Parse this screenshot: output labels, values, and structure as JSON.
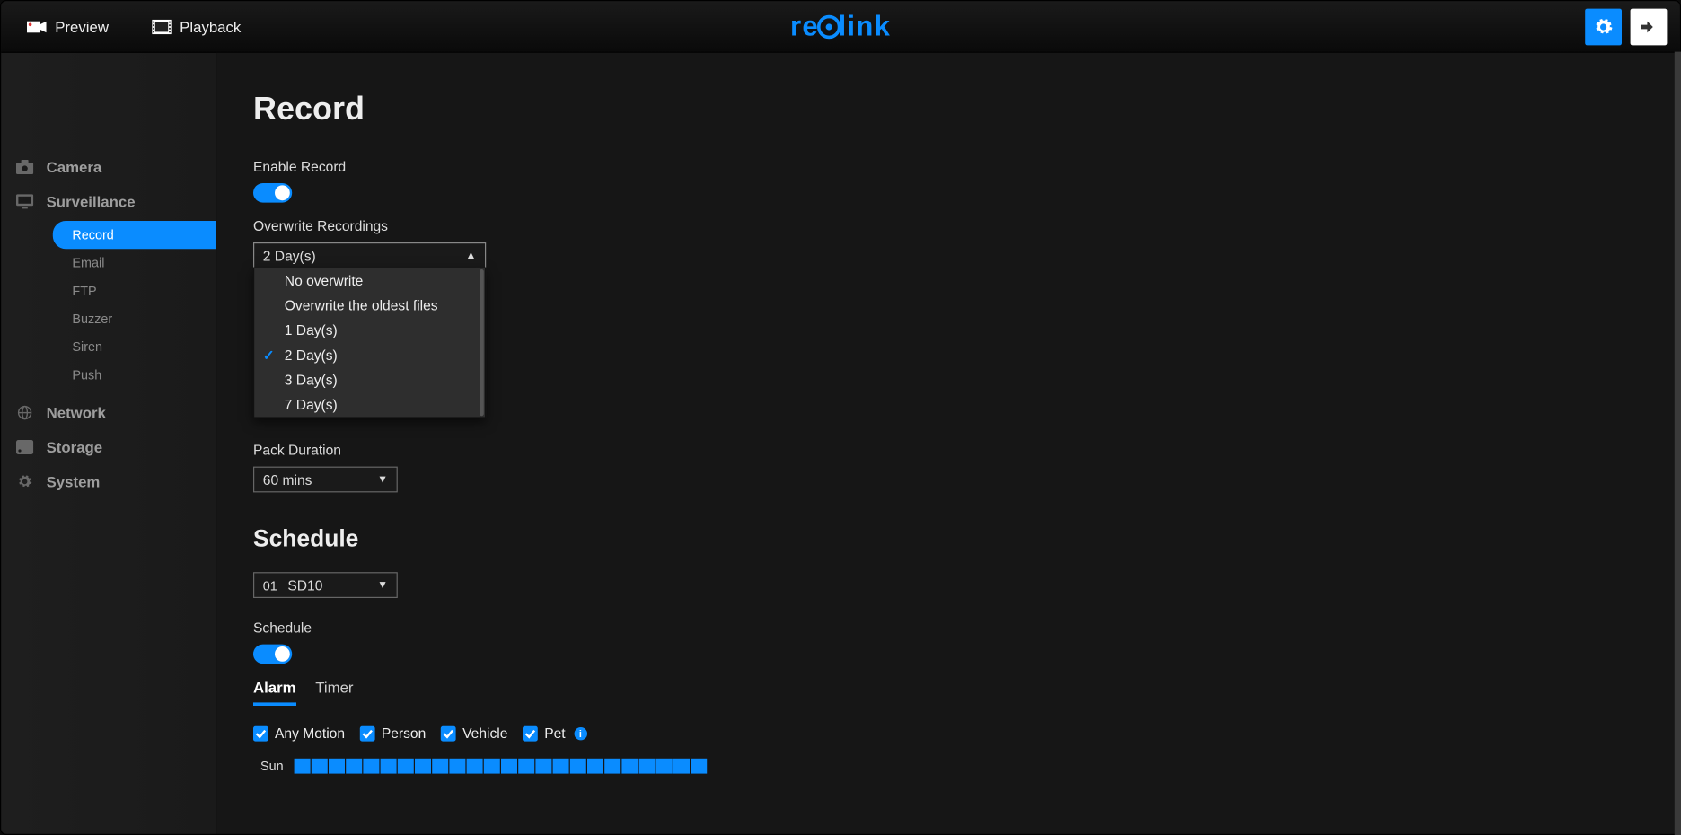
{
  "topbar": {
    "preview": "Preview",
    "playback": "Playback",
    "logo_pre": "re",
    "logo_post": "link"
  },
  "sidebar": {
    "camera": "Camera",
    "surveillance": "Surveillance",
    "sub": {
      "record": "Record",
      "email": "Email",
      "ftp": "FTP",
      "buzzer": "Buzzer",
      "siren": "Siren",
      "push": "Push"
    },
    "network": "Network",
    "storage": "Storage",
    "system": "System"
  },
  "page": {
    "title": "Record",
    "enable_label": "Enable Record",
    "overwrite_label": "Overwrite Recordings",
    "overwrite_value": "2 Day(s)",
    "overwrite_options": {
      "o0": "No overwrite",
      "o1": "Overwrite the oldest files",
      "o2": "1 Day(s)",
      "o3": "2 Day(s)",
      "o4": "3 Day(s)",
      "o5": "7 Day(s)"
    },
    "pack_label": "Pack Duration",
    "pack_value": "60 mins",
    "schedule_title": "Schedule",
    "cam_num": "01",
    "cam_name": "SD10",
    "schedule_label": "Schedule",
    "tabs": {
      "alarm": "Alarm",
      "timer": "Timer"
    },
    "chk": {
      "any": "Any Motion",
      "person": "Person",
      "vehicle": "Vehicle",
      "pet": "Pet"
    },
    "day": "Sun"
  }
}
